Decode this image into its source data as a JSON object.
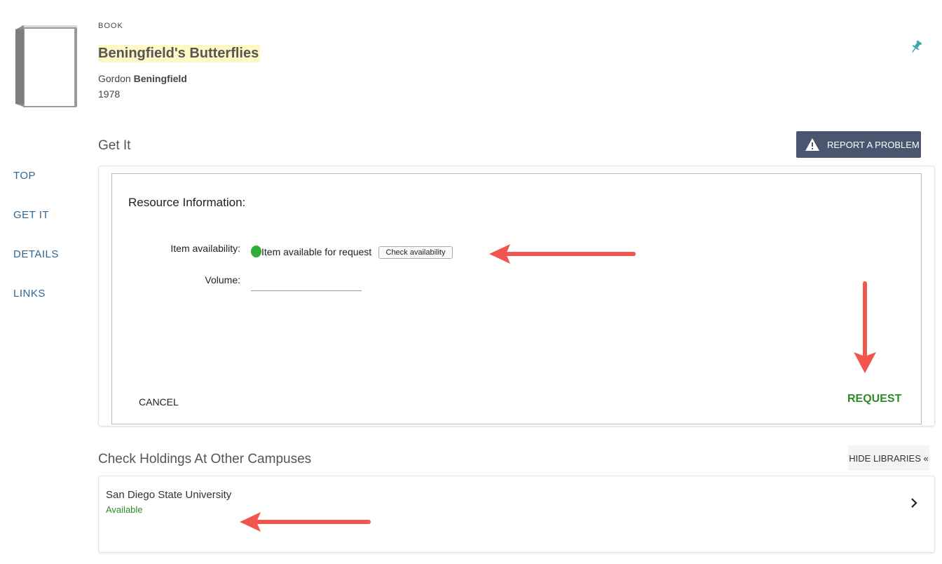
{
  "record": {
    "type": "BOOK",
    "title": "Beningfield's Butterflies",
    "author_first": "Gordon",
    "author_last": "Beningfield",
    "year": "1978"
  },
  "sidenav": {
    "items": [
      {
        "label": "TOP"
      },
      {
        "label": "GET IT"
      },
      {
        "label": "DETAILS"
      },
      {
        "label": "LINKS"
      }
    ]
  },
  "get_it": {
    "section_title": "Get It",
    "report_label": "REPORT A PROBLEM",
    "resource_heading": "Resource Information:",
    "availability_label": "Item availability:",
    "availability_status": "Item available for request",
    "check_button": "Check availability",
    "volume_label": "Volume:",
    "volume_value": "",
    "cancel_label": "CANCEL",
    "request_label": "REQUEST"
  },
  "holdings": {
    "section_title": "Check Holdings At Other Campuses",
    "hide_label": "HIDE LIBRARIES «",
    "campuses": [
      {
        "name": "San Diego State University",
        "status": "Available"
      }
    ]
  },
  "colors": {
    "nav_link": "#2f6693",
    "button_dark": "#4a5670",
    "available_green": "#2e8b26",
    "annotation_arrow": "#f0564e",
    "pin": "#3aa6b0"
  },
  "icons": [
    "book-cover-icon",
    "pin-icon",
    "warning-icon",
    "availability-dot-icon",
    "chevron-right-icon"
  ]
}
